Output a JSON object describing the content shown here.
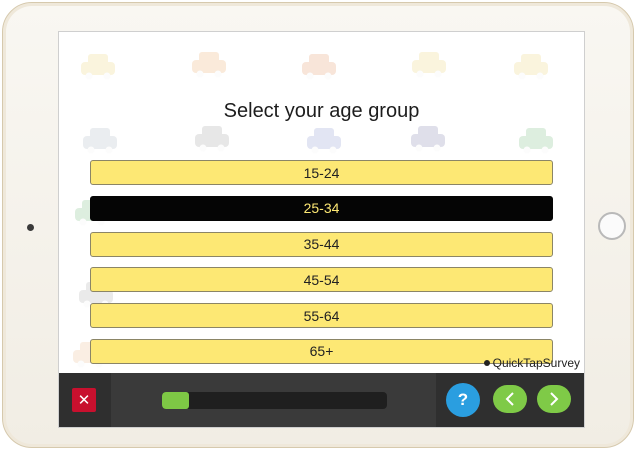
{
  "question": {
    "text": "Select your age group"
  },
  "options": [
    {
      "label": "15-24",
      "selected": false
    },
    {
      "label": "25-34",
      "selected": true
    },
    {
      "label": "35-44",
      "selected": false
    },
    {
      "label": "45-54",
      "selected": false
    },
    {
      "label": "55-64",
      "selected": false
    },
    {
      "label": "65+",
      "selected": false
    }
  ],
  "brand": {
    "name": "QuickTapSurvey"
  },
  "toolbar": {
    "close_glyph": "✕",
    "help_glyph": "?",
    "progress_fraction": 0.12,
    "icons": {
      "close": "close-icon",
      "back": "chevron-left-icon",
      "next": "chevron-right-icon"
    }
  },
  "colors": {
    "option_fill": "#fde874",
    "selected_fill": "#050505",
    "selected_text": "#fde874",
    "close_red": "#c8102e",
    "progress_green": "#7ec845",
    "help_blue": "#2a9ee0",
    "nav_green": "#7fca47",
    "toolbar_dark": "#3a3a3a"
  }
}
